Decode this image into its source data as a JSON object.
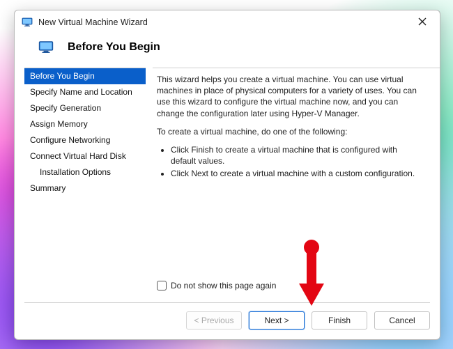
{
  "titlebar": {
    "title": "New Virtual Machine Wizard"
  },
  "header": {
    "heading": "Before You Begin"
  },
  "sidebar": {
    "items": [
      {
        "label": "Before You Begin",
        "selected": true,
        "indent": false
      },
      {
        "label": "Specify Name and Location",
        "selected": false,
        "indent": false
      },
      {
        "label": "Specify Generation",
        "selected": false,
        "indent": false
      },
      {
        "label": "Assign Memory",
        "selected": false,
        "indent": false
      },
      {
        "label": "Configure Networking",
        "selected": false,
        "indent": false
      },
      {
        "label": "Connect Virtual Hard Disk",
        "selected": false,
        "indent": false
      },
      {
        "label": "Installation Options",
        "selected": false,
        "indent": true
      },
      {
        "label": "Summary",
        "selected": false,
        "indent": false
      }
    ]
  },
  "content": {
    "intro": "This wizard helps you create a virtual machine. You can use virtual machines in place of physical computers for a variety of uses. You can use this wizard to configure the virtual machine now, and you can change the configuration later using Hyper-V Manager.",
    "lead": "To create a virtual machine, do one of the following:",
    "bullets": [
      "Click Finish to create a virtual machine that is configured with default values.",
      "Click Next to create a virtual machine with a custom configuration."
    ],
    "checkbox_label": "Do not show this page again"
  },
  "footer": {
    "previous": "< Previous",
    "next": "Next >",
    "finish": "Finish",
    "cancel": "Cancel"
  },
  "colors": {
    "selection": "#0a5fca",
    "annotation": "#e30613"
  }
}
